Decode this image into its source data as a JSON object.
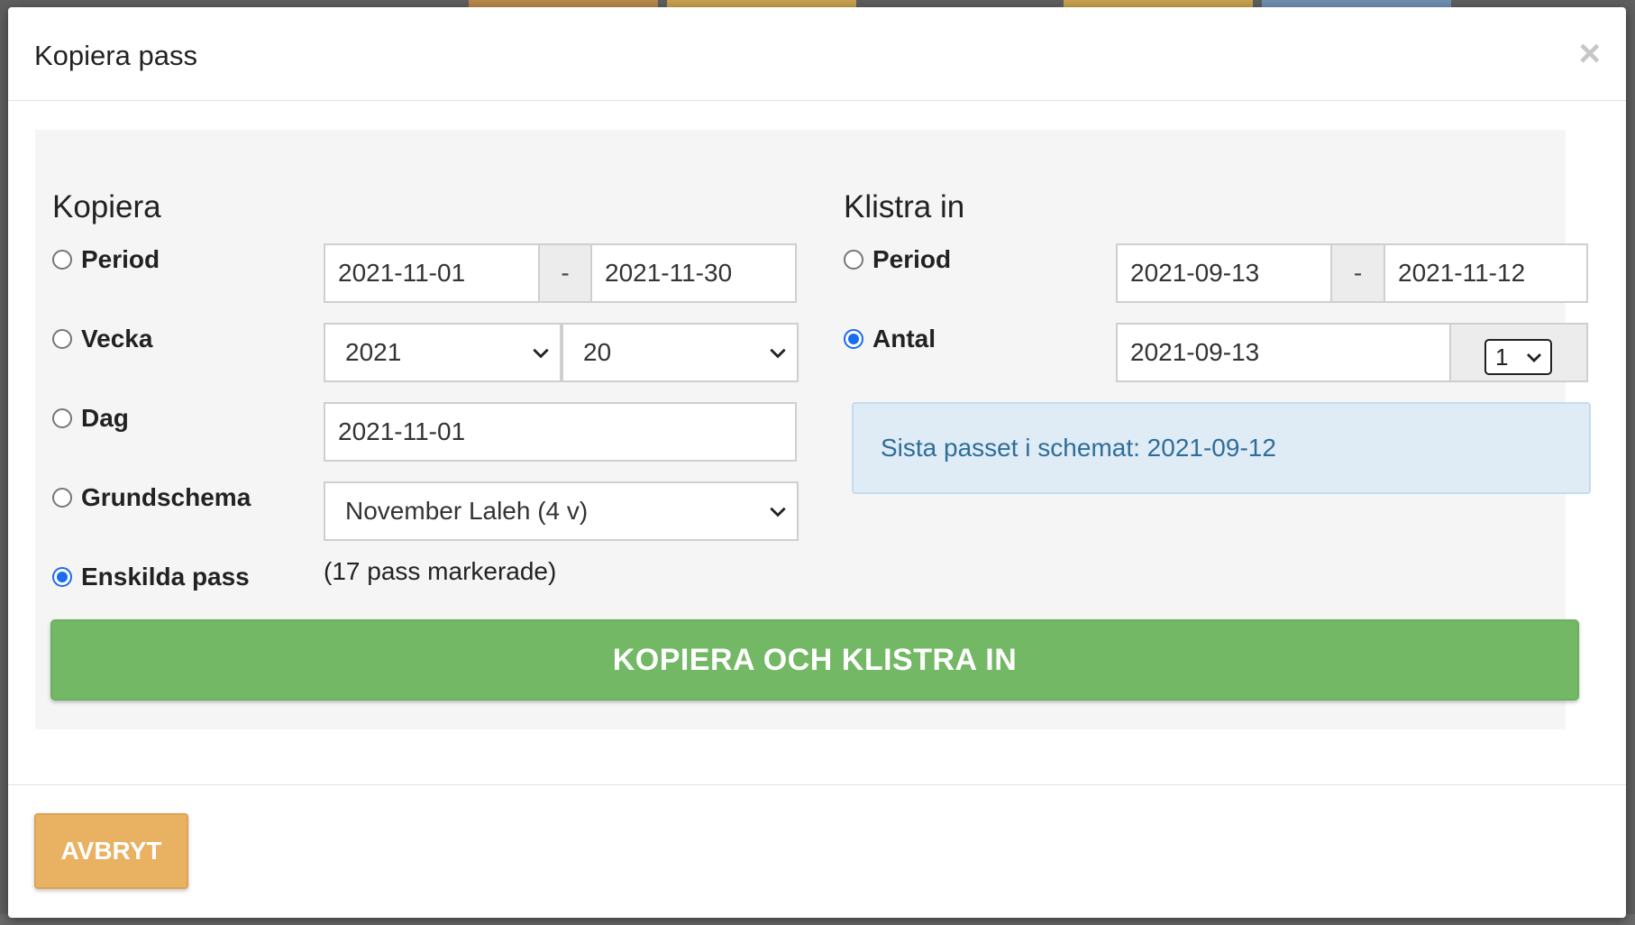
{
  "dialog": {
    "title": "Kopiera pass",
    "close_symbol": "×"
  },
  "copy": {
    "heading": "Kopiera",
    "options": {
      "period": {
        "label": "Period",
        "selected": false
      },
      "week": {
        "label": "Vecka",
        "selected": false
      },
      "day": {
        "label": "Dag",
        "selected": false
      },
      "base_schedule": {
        "label": "Grundschema",
        "selected": false
      },
      "individual_shifts": {
        "label": "Enskilda pass",
        "selected": true
      }
    },
    "period_from": "2021-11-01",
    "period_separator": "-",
    "period_to": "2021-11-30",
    "week_year": "2021",
    "week_number": "20",
    "day_date": "2021-11-01",
    "base_schedule_value": "November Laleh (4 v)",
    "marked_count_text": "(17 pass markerade)"
  },
  "paste": {
    "heading": "Klistra in",
    "options": {
      "period": {
        "label": "Period",
        "selected": false
      },
      "count": {
        "label": "Antal",
        "selected": true
      }
    },
    "period_from": "2021-09-13",
    "period_separator": "-",
    "period_to": "2021-11-12",
    "count_start_date": "2021-09-13",
    "count_value": "1",
    "info_text": "Sista passet i schemat: 2021-09-12"
  },
  "actions": {
    "copy_paste_label": "KOPIERA OCH KLISTRA IN",
    "cancel_label": "AVBRYT"
  },
  "colors": {
    "primary_green": "#73b865",
    "cancel_orange": "#e9b162",
    "radio_blue": "#1a6cf0",
    "info_bg": "#dfecf6",
    "info_text": "#2f6d9a"
  }
}
